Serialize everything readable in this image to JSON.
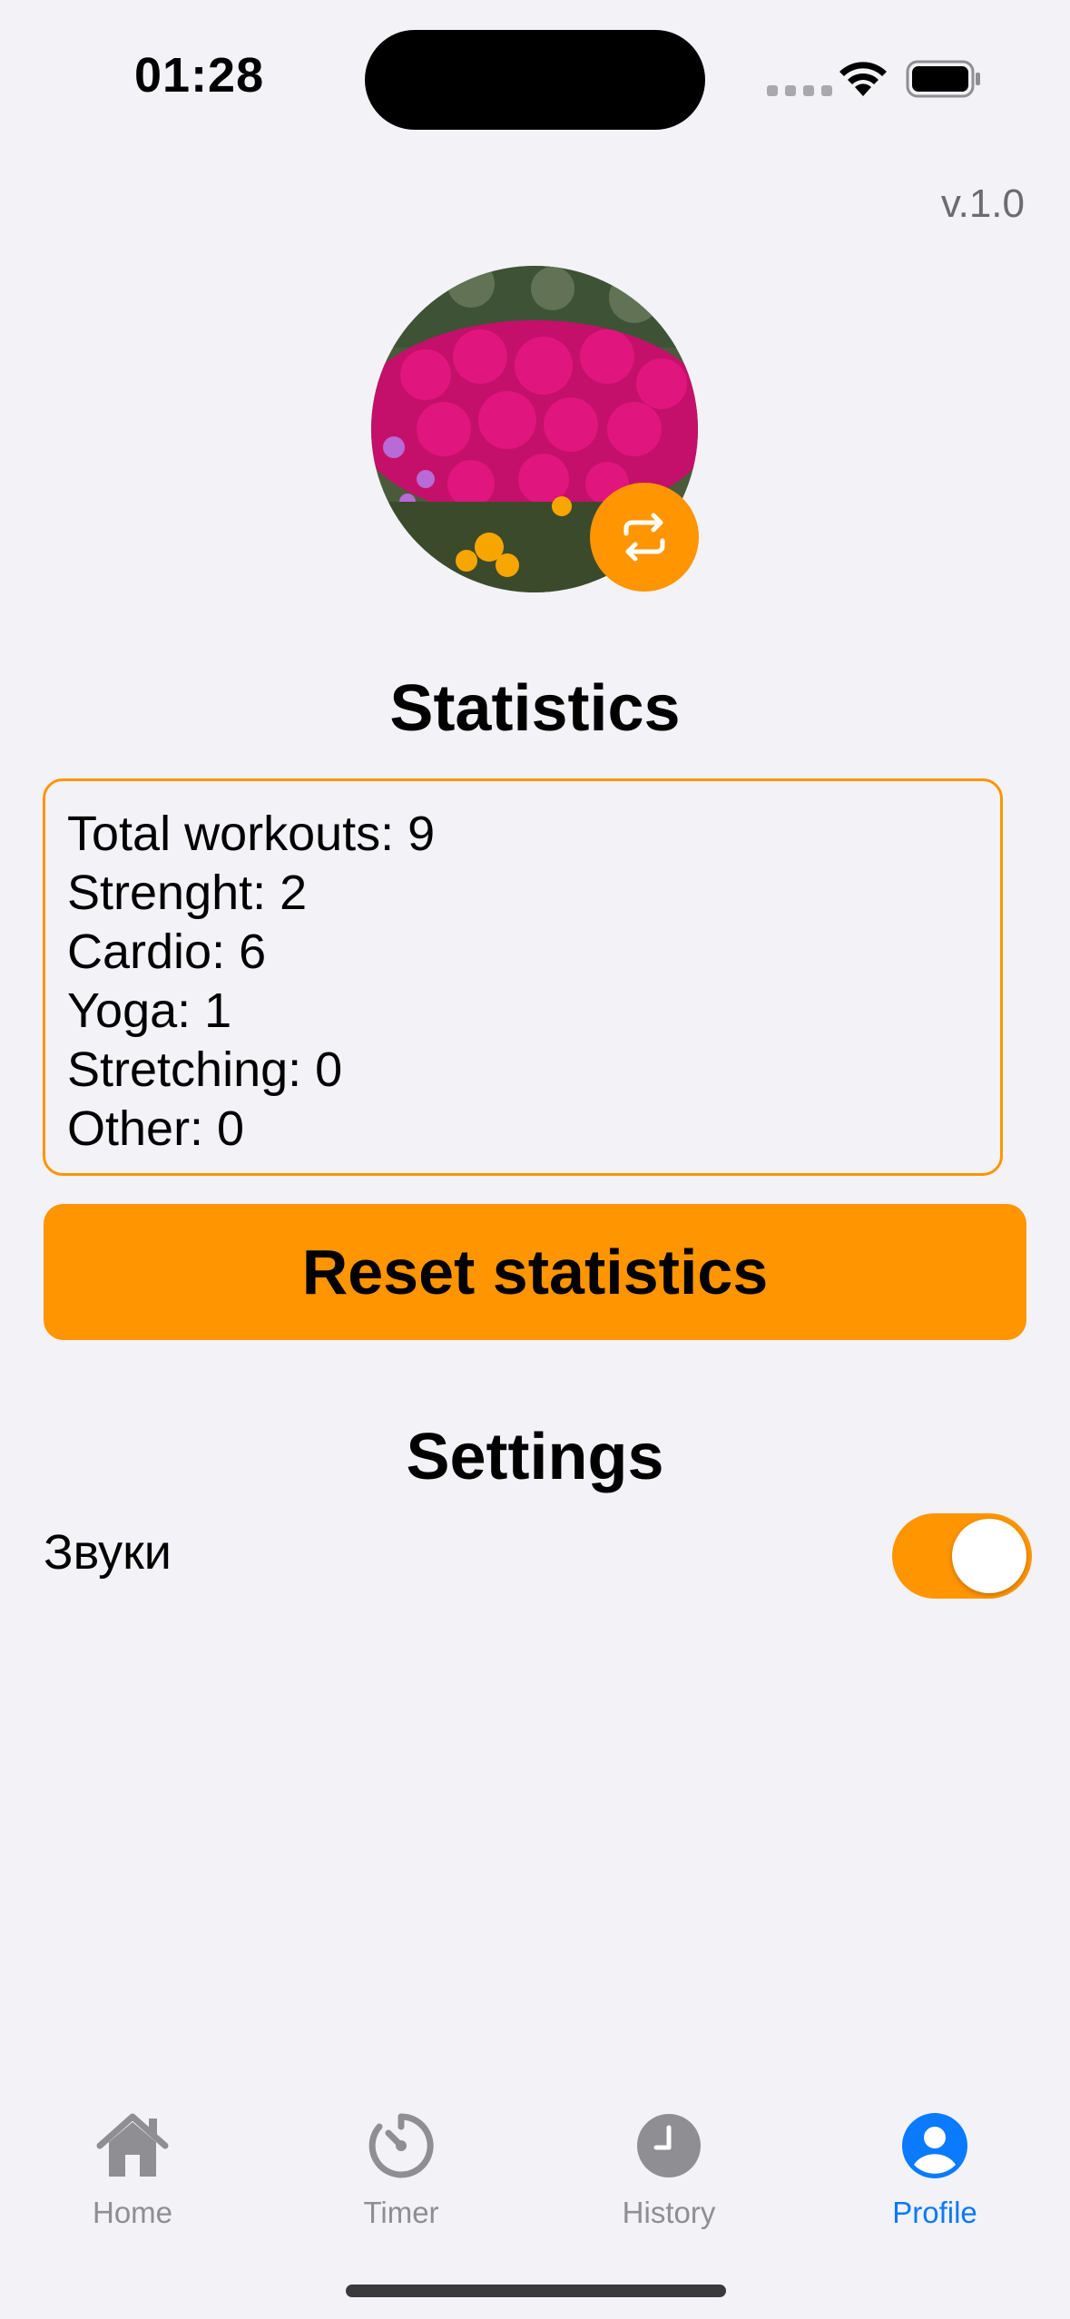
{
  "status_bar": {
    "time": "01:28"
  },
  "version": "v.1.0",
  "avatar": {
    "swap_icon": "swap-arrows-icon"
  },
  "statistics": {
    "title": "Statistics",
    "lines": [
      "Total workouts: 9",
      "Strenght: 2",
      "Cardio: 6",
      "Yoga: 1",
      "Stretching: 0",
      "Other: 0"
    ],
    "reset_label": "Reset statistics"
  },
  "settings": {
    "title": "Settings",
    "sounds_label": "Звуки",
    "sounds_enabled": true
  },
  "tabs": [
    {
      "label": "Home",
      "icon": "house-icon",
      "active": false
    },
    {
      "label": "Timer",
      "icon": "timer-icon",
      "active": false
    },
    {
      "label": "History",
      "icon": "clock-icon",
      "active": false
    },
    {
      "label": "Profile",
      "icon": "person-circle-icon",
      "active": true
    }
  ],
  "colors": {
    "accent": "#ff9500",
    "active_tab": "#0a7aff",
    "inactive_tab": "#8e8e93",
    "background": "#f2f2f7"
  }
}
